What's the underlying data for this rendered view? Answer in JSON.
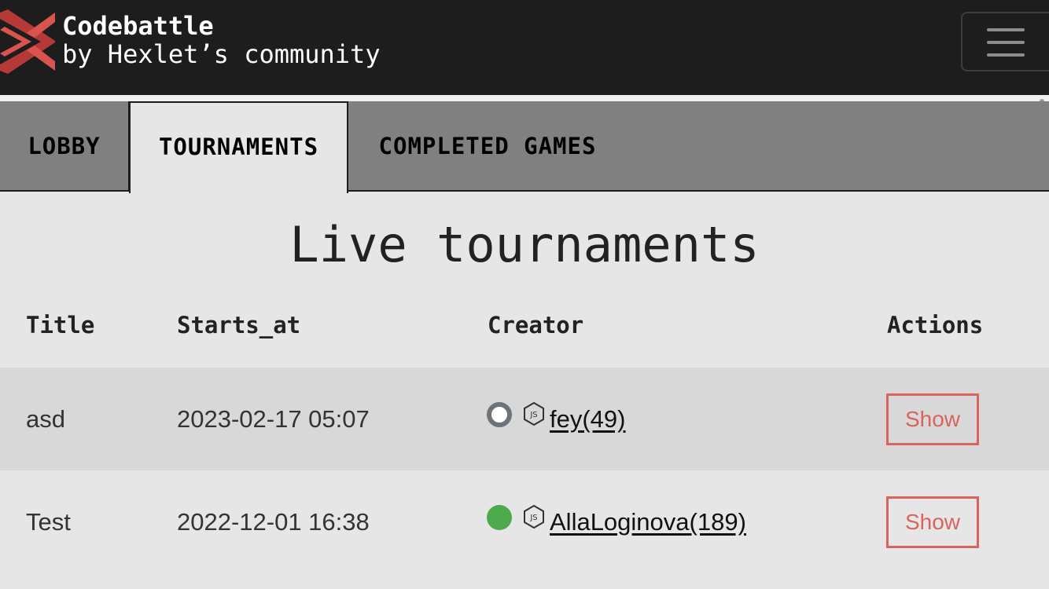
{
  "navbar": {
    "brand_title": "Codebattle",
    "brand_subtitle": "by Hexlet’s community",
    "logo_icon": "codebattle-logo-icon",
    "menu_icon": "hamburger-menu-icon"
  },
  "tabs": [
    {
      "label": "LOBBY",
      "active": false
    },
    {
      "label": "TOURNAMENTS",
      "active": true
    },
    {
      "label": "COMPLETED GAMES",
      "active": false
    }
  ],
  "main": {
    "title": "Live tournaments",
    "columns": [
      "Title",
      "Starts_at",
      "Creator",
      "Actions"
    ],
    "rows": [
      {
        "title": "asd",
        "starts_at": "2023-02-17 05:07",
        "creator": "fey(49)",
        "status": "offline",
        "lang_icon": "nodejs-icon",
        "action": "Show"
      },
      {
        "title": "Test",
        "starts_at": "2022-12-01 16:38",
        "creator": "AllaLoginova(189)",
        "status": "online",
        "lang_icon": "nodejs-icon",
        "action": "Show"
      }
    ]
  },
  "colors": {
    "navbar_bg": "#1d1d1d",
    "tabbar_bg": "#808080",
    "page_bg": "#e6e6e6",
    "accent_red": "#d9645e",
    "online_green": "#4caa4d",
    "offline_gray": "#6c737a"
  }
}
